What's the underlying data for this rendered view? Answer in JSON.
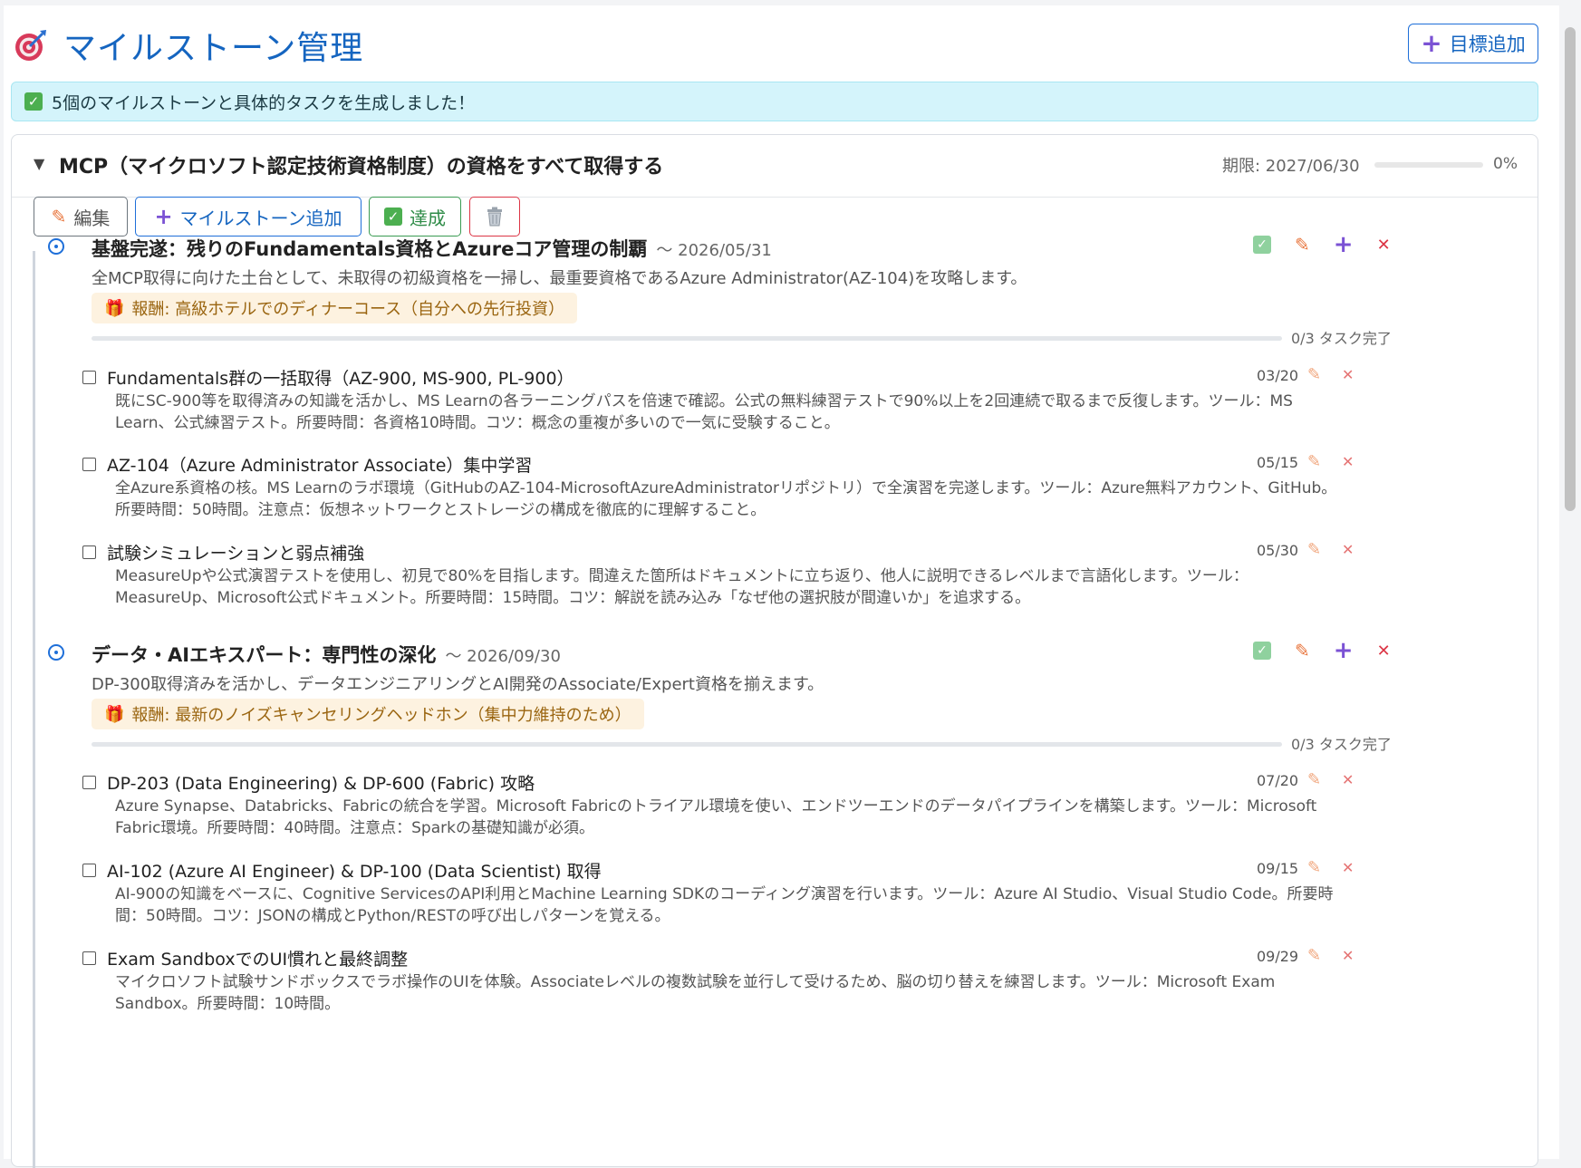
{
  "header": {
    "title": "マイルストーン管理",
    "add_goal_label": "目標追加"
  },
  "alert": {
    "text": "5個のマイルストーンと具体的タスクを生成しました！"
  },
  "goal": {
    "title": "MCP（マイクロソフト認定技術資格制度）の資格をすべて取得する",
    "deadline": "期限: 2027/06/30",
    "progress": "0%",
    "progress_value": 0,
    "actions": {
      "edit": "編集",
      "add_milestone": "マイルストーン追加",
      "done": "達成"
    }
  },
  "milestones": [
    {
      "title": "基盤完遂：残りのFundamentals資格とAzureコア管理の制覇",
      "due": "～ 2026/05/31",
      "description": "全MCP取得に向けた土台として、未取得の初級資格を一掃し、最重要資格であるAzure Administrator(AZ-104)を攻略します。",
      "reward": "報酬: 高級ホテルでのディナーコース（自分への先行投資）",
      "progress_text": "0/3 タスク完了",
      "tasks": [
        {
          "title": "Fundamentals群の一括取得（AZ-900, MS-900, PL-900）",
          "date": "03/20",
          "description": "既にSC-900等を取得済みの知識を活かし、MS Learnの各ラーニングパスを倍速で確認。公式の無料練習テストで90%以上を2回連続で取るまで反復します。ツール：MS Learn、公式練習テスト。所要時間：各資格10時間。コツ：概念の重複が多いので一気に受験すること。"
        },
        {
          "title": "AZ-104（Azure Administrator Associate）集中学習",
          "date": "05/15",
          "description": "全Azure系資格の核。MS Learnのラボ環境（GitHubのAZ-104-MicrosoftAzureAdministratorリポジトリ）で全演習を完遂します。ツール：Azure無料アカウント、GitHub。所要時間：50時間。注意点：仮想ネットワークとストレージの構成を徹底的に理解すること。"
        },
        {
          "title": "試験シミュレーションと弱点補強",
          "date": "05/30",
          "description": "MeasureUpや公式演習テストを使用し、初見で80%を目指します。間違えた箇所はドキュメントに立ち返り、他人に説明できるレベルまで言語化します。ツール：MeasureUp、Microsoft公式ドキュメント。所要時間：15時間。コツ：解説を読み込み「なぜ他の選択肢が間違いか」を追求する。"
        }
      ]
    },
    {
      "title": "データ・AIエキスパート：専門性の深化",
      "due": "～ 2026/09/30",
      "description": "DP-300取得済みを活かし、データエンジニアリングとAI開発のAssociate/Expert資格を揃えます。",
      "reward": "報酬: 最新のノイズキャンセリングヘッドホン（集中力維持のため）",
      "progress_text": "0/3 タスク完了",
      "tasks": [
        {
          "title": "DP-203 (Data Engineering) & DP-600 (Fabric) 攻略",
          "date": "07/20",
          "description": "Azure Synapse、Databricks、Fabricの統合を学習。Microsoft Fabricのトライアル環境を使い、エンドツーエンドのデータパイプラインを構築します。ツール：Microsoft Fabric環境。所要時間：40時間。注意点：Sparkの基礎知識が必須。"
        },
        {
          "title": "AI-102 (Azure AI Engineer) & DP-100 (Data Scientist) 取得",
          "date": "09/15",
          "description": "AI-900の知識をベースに、Cognitive ServicesのAPI利用とMachine Learning SDKのコーディング演習を行います。ツール：Azure AI Studio、Visual Studio Code。所要時間：50時間。コツ：JSONの構成とPython/RESTの呼び出しパターンを覚える。"
        },
        {
          "title": "Exam SandboxでのUI慣れと最終調整",
          "date": "09/29",
          "description": "マイクロソフト試験サンドボックスでラボ操作のUIを体験。Associateレベルの複数試験を並行して受けるため、脳の切り替えを練習します。ツール：Microsoft Exam Sandbox。所要時間：10時間。"
        }
      ]
    }
  ]
}
